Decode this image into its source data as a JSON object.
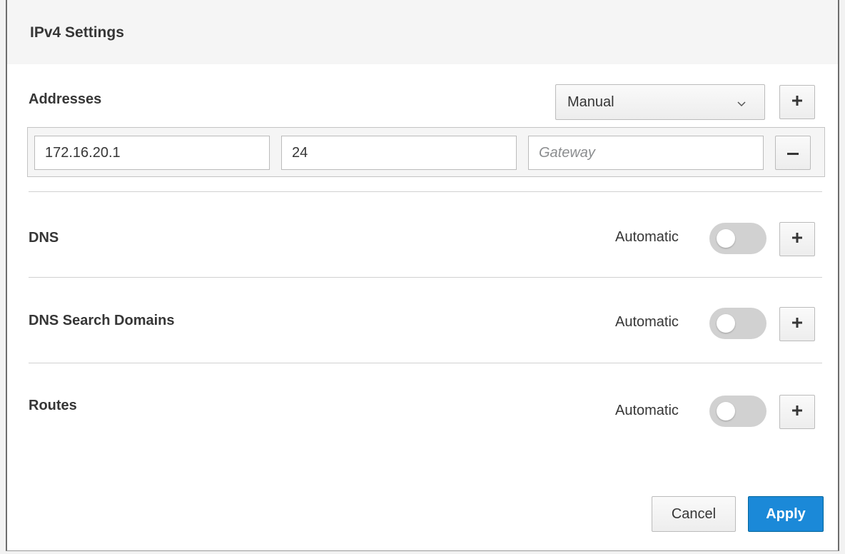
{
  "dialog": {
    "title": "IPv4 Settings"
  },
  "addresses": {
    "label": "Addresses",
    "method": "Manual",
    "add_icon": "plus-icon",
    "remove_icon": "minus-icon",
    "rows": [
      {
        "address": "172.16.20.1",
        "prefix": "24",
        "gateway": "",
        "gateway_placeholder": "Gateway"
      }
    ]
  },
  "dns": {
    "label": "DNS",
    "automatic_label": "Automatic",
    "automatic_on": false
  },
  "dns_search": {
    "label": "DNS Search Domains",
    "automatic_label": "Automatic",
    "automatic_on": false
  },
  "routes": {
    "label": "Routes",
    "automatic_label": "Automatic",
    "automatic_on": false
  },
  "footer": {
    "cancel_label": "Cancel",
    "apply_label": "Apply"
  },
  "colors": {
    "primary": "#1b89d8",
    "toggle_off": "#d1d1d1"
  }
}
